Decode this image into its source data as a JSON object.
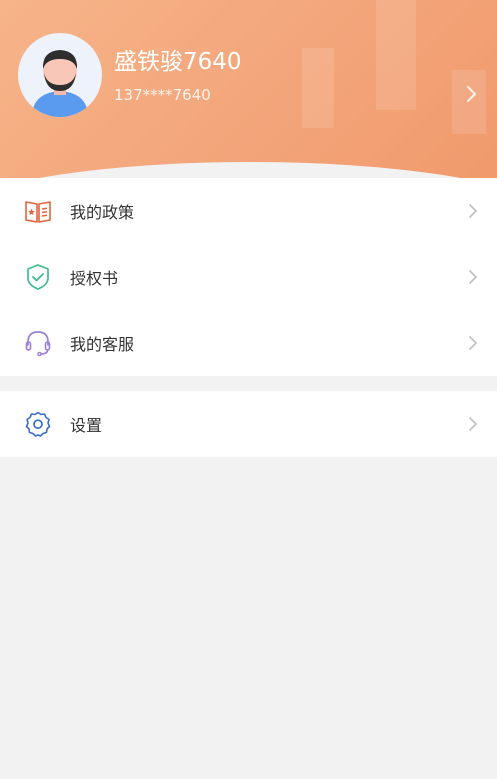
{
  "profile": {
    "name": "盛铁骏7640",
    "phone": "137****7640",
    "avatar_icon": "avatar-icon",
    "accent_color": "#f3a57a"
  },
  "menu": {
    "items": [
      {
        "label": "我的政策",
        "icon": "policy-book-icon",
        "color": "#e0643c"
      },
      {
        "label": "授权书",
        "icon": "shield-check-icon",
        "color": "#3cc08c"
      },
      {
        "label": "我的客服",
        "icon": "headset-icon",
        "color": "#9b7fd8"
      }
    ],
    "settings": {
      "label": "设置",
      "icon": "gear-icon",
      "color": "#3a6fc4"
    }
  }
}
